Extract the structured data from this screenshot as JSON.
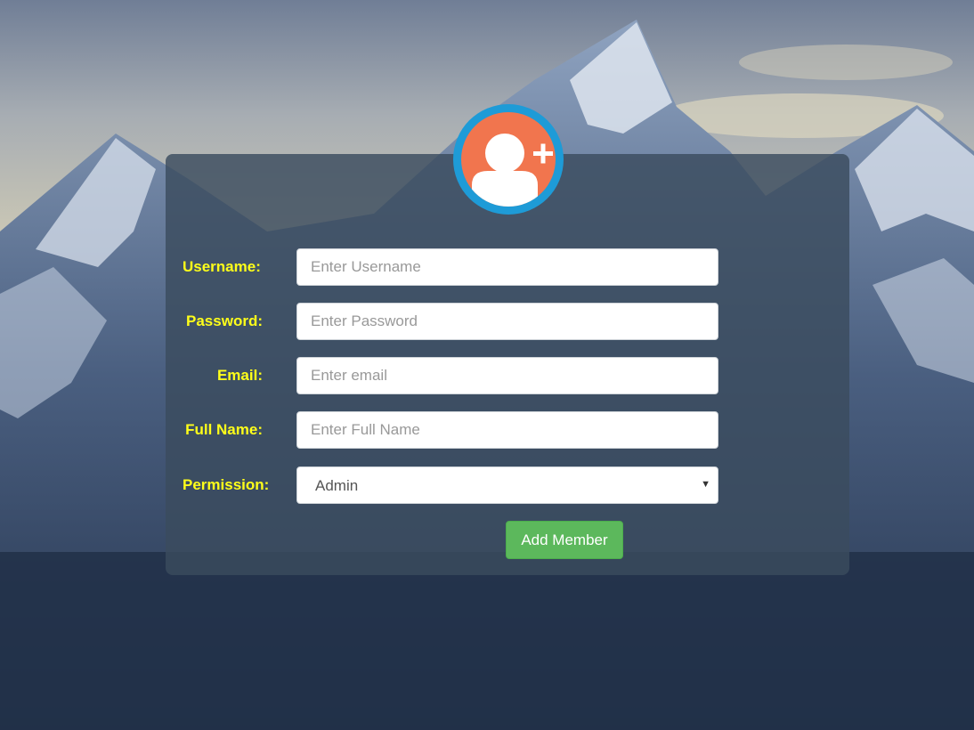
{
  "form": {
    "fields": {
      "username": {
        "label": "Username:",
        "placeholder": "Enter Username",
        "value": ""
      },
      "password": {
        "label": "Password:",
        "placeholder": "Enter Password",
        "value": ""
      },
      "email": {
        "label": "Email:",
        "placeholder": "Enter email",
        "value": ""
      },
      "fullname": {
        "label": "Full Name:",
        "placeholder": "Enter Full Name",
        "value": ""
      },
      "permission": {
        "label": "Permission:",
        "selected": "Admin"
      }
    },
    "submit_label": "Add Member"
  },
  "avatar": {
    "icon": "add-user-icon"
  },
  "colors": {
    "label": "#ffff1a",
    "button": "#5cb85c",
    "avatar_ring": "#1e9bd7",
    "avatar_fill": "#f1754e",
    "panel": "#3a4c5e"
  }
}
